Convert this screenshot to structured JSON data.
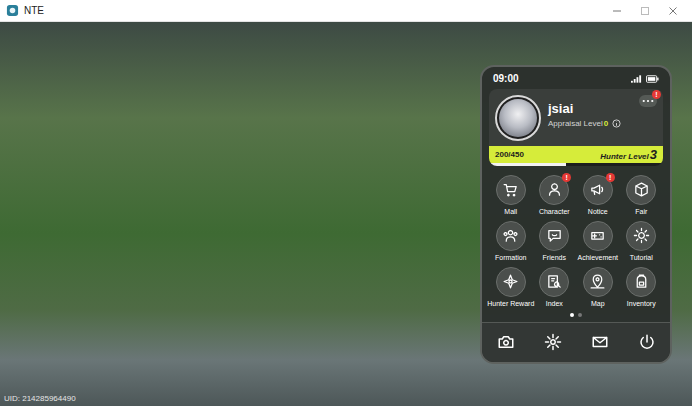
{
  "window": {
    "title": "NTE"
  },
  "uid": "UID: 214285964490",
  "phone": {
    "time": "09:00",
    "alert_mark": "!",
    "profile": {
      "name": "jsiai",
      "appraisal_label": "Appraisal Level",
      "appraisal_level": "0",
      "menu_alert": true
    },
    "hunter": {
      "xp": "200/450",
      "label": "Hunter Level",
      "level": "3",
      "progress": 0.44
    },
    "apps": [
      {
        "label": "Mall",
        "alert": false
      },
      {
        "label": "Character",
        "alert": true
      },
      {
        "label": "Notice",
        "alert": true
      },
      {
        "label": "Fair",
        "alert": false
      },
      {
        "label": "Formation",
        "alert": false
      },
      {
        "label": "Friends",
        "alert": false
      },
      {
        "label": "Achievement",
        "alert": false
      },
      {
        "label": "Tutorial",
        "alert": false
      },
      {
        "label": "Hunter Reward",
        "alert": false
      },
      {
        "label": "Index",
        "alert": false
      },
      {
        "label": "Map",
        "alert": false
      },
      {
        "label": "Inventory",
        "alert": false
      }
    ],
    "pages": [
      {
        "selected": true
      },
      {
        "selected": false
      }
    ]
  }
}
